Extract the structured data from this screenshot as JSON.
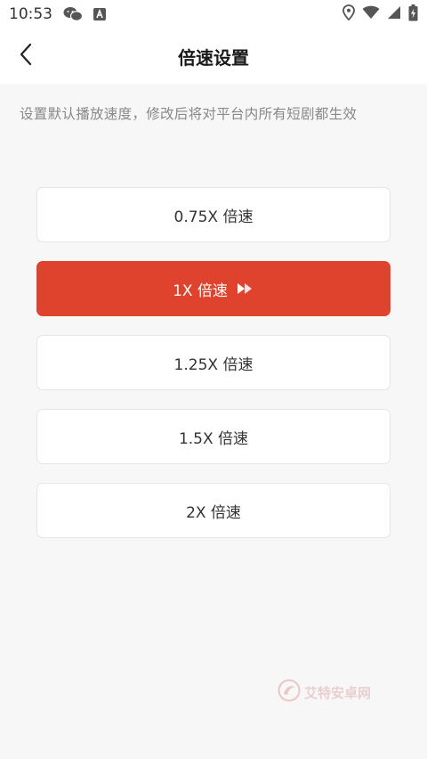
{
  "statusbar": {
    "time": "10:53",
    "icons": [
      "wechat-icon",
      "a-badge-icon",
      "location-icon",
      "wifi-icon",
      "signal-icon",
      "battery-icon"
    ]
  },
  "header": {
    "title": "倍速设置",
    "back_icon": "chevron-left-icon"
  },
  "hint": "设置默认播放速度，修改后将对平台内所有短剧都生效",
  "options": [
    {
      "label": "0.75X 倍速",
      "selected": false
    },
    {
      "label": "1X 倍速",
      "selected": true
    },
    {
      "label": "1.25X 倍速",
      "selected": false
    },
    {
      "label": "1.5X 倍速",
      "selected": false
    },
    {
      "label": "2X 倍速",
      "selected": false
    }
  ],
  "watermark": {
    "text": "艾特安卓网"
  },
  "colors": {
    "accent": "#e0432d",
    "background": "#f7f7f7",
    "hint_text": "#888888"
  }
}
